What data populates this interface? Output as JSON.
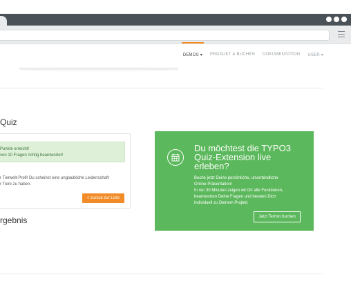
{
  "nav": {
    "items": [
      {
        "label": "DEMOS",
        "caret": "▾",
        "active": true
      },
      {
        "label": "PRODUKT & BUCHEN",
        "caret": "",
        "active": false
      },
      {
        "label": "DOKUMENTATION",
        "caret": "",
        "active": false
      },
      {
        "label": "USER",
        "caret": "▾",
        "active": false
      }
    ]
  },
  "quiz": {
    "title": "Quiz",
    "alert_line1": "Punkte erreicht!",
    "alert_line2": "von 10 Fragen richtig beantwortet!",
    "text_line1": "r Tierwelt-Profi! Du scheinst eine unglaubliche Leidenschaft",
    "text_line2": "r Tiere zu haben.",
    "back_button": "< zurück zur Liste",
    "result_heading": "rgebnis"
  },
  "cta": {
    "icon": "calendar-icon",
    "title_line1": "Du möchtest die TYPO3",
    "title_line2": "Quiz-Extension live",
    "title_line3": "erleben?",
    "body_line1": "Buche jetzt Deine persönliche, unverbindliche",
    "body_line2": "Online-Präsentation!",
    "body_line3": "In nur 30 Minuten zeigen wir Dir alle Funktionen,",
    "body_line4": "beantworten Deine Fragen und beraten Dich",
    "body_line5": "individuell zu Deinem Projekt.",
    "button": "Jetzt Termin buchen"
  },
  "colors": {
    "accent": "#f28c28",
    "cta_green": "#5cb85c",
    "alert_bg": "#def0d8",
    "chrome_dark": "#4b5257"
  }
}
